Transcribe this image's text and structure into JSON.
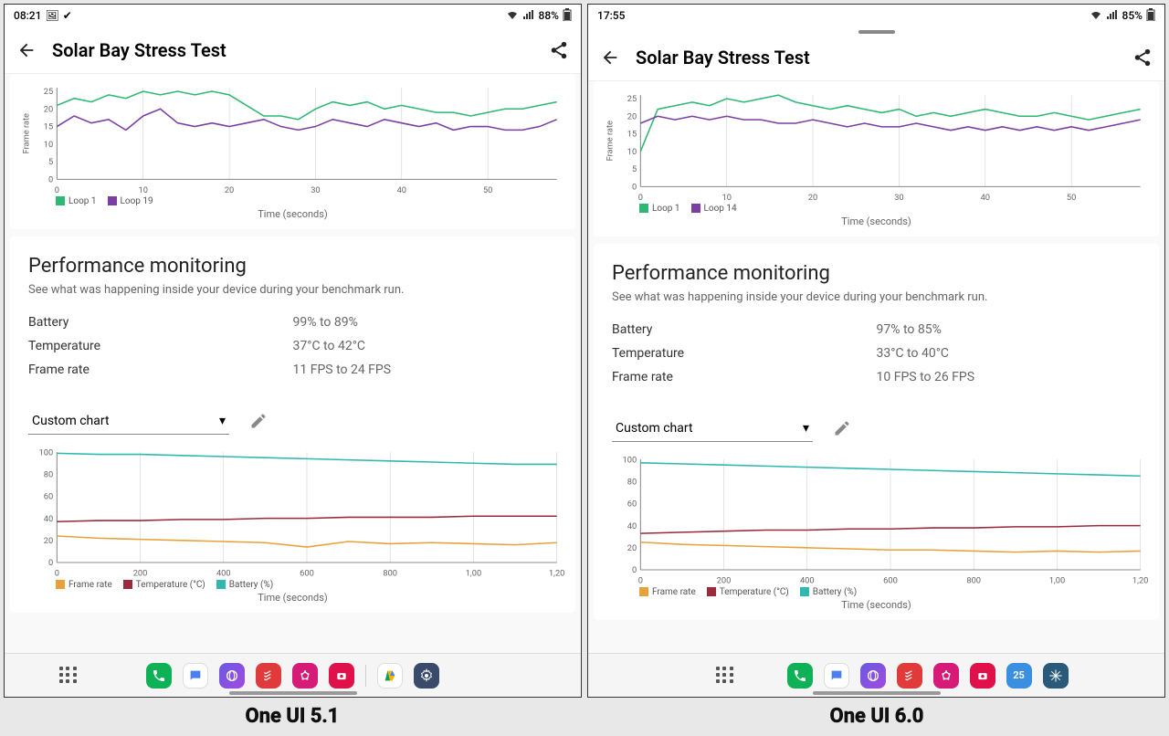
{
  "captions": {
    "left": "One UI 5.1",
    "right": "One UI 6.0"
  },
  "left": {
    "status": {
      "time": "08:21",
      "battery": "88%"
    },
    "app_title": "Solar Bay Stress Test",
    "has_drag_handle": false,
    "frame_chart": {
      "legend": [
        "Loop 1",
        "Loop 19"
      ],
      "xlabel": "Time (seconds)",
      "ylabel": "Frame rate"
    },
    "perf": {
      "title": "Performance monitoring",
      "subtitle": "See what was happening inside your device during your benchmark run.",
      "rows": [
        {
          "label": "Battery",
          "value": "99% to 89%"
        },
        {
          "label": "Temperature",
          "value": "37°C to 42°C"
        },
        {
          "label": "Frame rate",
          "value": "11 FPS to 24 FPS"
        }
      ]
    },
    "custom_chart_label": "Custom chart",
    "custom_chart": {
      "legend": [
        "Frame rate",
        "Temperature (°C)",
        "Battery (%)"
      ],
      "xlabel": "Time (seconds)"
    }
  },
  "right": {
    "status": {
      "time": "17:55",
      "battery": "85%"
    },
    "app_title": "Solar Bay Stress Test",
    "has_drag_handle": true,
    "frame_chart": {
      "legend": [
        "Loop 1",
        "Loop 14"
      ],
      "xlabel": "Time (seconds)",
      "ylabel": "Frame rate"
    },
    "perf": {
      "title": "Performance monitoring",
      "subtitle": "See what was happening inside your device during your benchmark run.",
      "rows": [
        {
          "label": "Battery",
          "value": "97% to 85%"
        },
        {
          "label": "Temperature",
          "value": "33°C to 40°C"
        },
        {
          "label": "Frame rate",
          "value": "10 FPS to 26 FPS"
        }
      ]
    },
    "custom_chart_label": "Custom chart",
    "custom_chart": {
      "legend": [
        "Frame rate",
        "Temperature (°C)",
        "Battery (%)"
      ],
      "xlabel": "Time (seconds)"
    }
  },
  "chart_data": [
    {
      "type": "line",
      "title": "Frame rate — One UI 5.1",
      "xlabel": "Time (seconds)",
      "ylabel": "Frame rate",
      "ylim": [
        0,
        26
      ],
      "xlim": [
        0,
        58
      ],
      "x": [
        0,
        2,
        4,
        6,
        8,
        10,
        12,
        14,
        16,
        18,
        20,
        22,
        24,
        26,
        28,
        30,
        32,
        34,
        36,
        38,
        40,
        42,
        44,
        46,
        48,
        50,
        52,
        54,
        56,
        58
      ],
      "series": [
        {
          "name": "Loop 1",
          "color": "#2eb873",
          "values": [
            21,
            23,
            22,
            24,
            23,
            25,
            24,
            25,
            24,
            25,
            24,
            21,
            18,
            18,
            17,
            20,
            22,
            21,
            22,
            20,
            21,
            20,
            19,
            19,
            18,
            19,
            20,
            20,
            21,
            22
          ]
        },
        {
          "name": "Loop 19",
          "color": "#7a3fa0",
          "values": [
            15,
            18,
            16,
            17,
            14,
            18,
            20,
            16,
            15,
            16,
            15,
            16,
            17,
            15,
            14,
            15,
            17,
            16,
            15,
            17,
            16,
            15,
            16,
            14,
            15,
            15,
            14,
            14,
            15,
            17
          ]
        }
      ]
    },
    {
      "type": "line",
      "title": "Custom chart — One UI 5.1",
      "xlabel": "Time (seconds)",
      "ylabel": "",
      "ylim": [
        0,
        100
      ],
      "xlim": [
        0,
        1200
      ],
      "x": [
        0,
        100,
        200,
        300,
        400,
        500,
        600,
        700,
        800,
        900,
        1000,
        1100,
        1200
      ],
      "series": [
        {
          "name": "Frame rate",
          "color": "#e8a23c",
          "values": [
            24,
            22,
            21,
            20,
            19,
            18,
            14,
            19,
            17,
            18,
            17,
            16,
            18
          ]
        },
        {
          "name": "Temperature (°C)",
          "color": "#9a2a3c",
          "values": [
            37,
            38,
            38,
            39,
            39,
            40,
            40,
            41,
            41,
            41,
            42,
            42,
            42
          ]
        },
        {
          "name": "Battery (%)",
          "color": "#2fb8b0",
          "values": [
            99,
            98,
            98,
            97,
            96,
            95,
            94,
            93,
            92,
            91,
            90,
            89,
            89
          ]
        }
      ]
    },
    {
      "type": "line",
      "title": "Frame rate — One UI 6.0",
      "xlabel": "Time (seconds)",
      "ylabel": "Frame rate",
      "ylim": [
        0,
        26
      ],
      "xlim": [
        0,
        58
      ],
      "x": [
        0,
        2,
        4,
        6,
        8,
        10,
        12,
        14,
        16,
        18,
        20,
        22,
        24,
        26,
        28,
        30,
        32,
        34,
        36,
        38,
        40,
        42,
        44,
        46,
        48,
        50,
        52,
        54,
        56,
        58
      ],
      "series": [
        {
          "name": "Loop 1",
          "color": "#2eb873",
          "values": [
            10,
            22,
            23,
            24,
            23,
            25,
            24,
            25,
            26,
            24,
            23,
            22,
            23,
            22,
            21,
            22,
            20,
            21,
            20,
            21,
            22,
            21,
            20,
            20,
            21,
            20,
            19,
            20,
            21,
            22
          ]
        },
        {
          "name": "Loop 14",
          "color": "#7a3fa0",
          "values": [
            18,
            20,
            19,
            20,
            19,
            20,
            19,
            19,
            18,
            18,
            19,
            18,
            17,
            18,
            17,
            17,
            18,
            17,
            16,
            17,
            16,
            17,
            16,
            17,
            16,
            17,
            16,
            17,
            18,
            19
          ]
        }
      ]
    },
    {
      "type": "line",
      "title": "Custom chart — One UI 6.0",
      "xlabel": "Time (seconds)",
      "ylabel": "",
      "ylim": [
        0,
        100
      ],
      "xlim": [
        0,
        1200
      ],
      "x": [
        0,
        100,
        200,
        300,
        400,
        500,
        600,
        700,
        800,
        900,
        1000,
        1100,
        1200
      ],
      "series": [
        {
          "name": "Frame rate",
          "color": "#e8a23c",
          "values": [
            25,
            23,
            22,
            21,
            20,
            19,
            18,
            18,
            17,
            16,
            17,
            16,
            17
          ]
        },
        {
          "name": "Temperature (°C)",
          "color": "#9a2a3c",
          "values": [
            33,
            34,
            35,
            36,
            36,
            37,
            37,
            38,
            38,
            39,
            39,
            40,
            40
          ]
        },
        {
          "name": "Battery (%)",
          "color": "#2fb8b0",
          "values": [
            97,
            96,
            95,
            94,
            93,
            92,
            91,
            90,
            89,
            88,
            87,
            86,
            85
          ]
        }
      ]
    }
  ]
}
